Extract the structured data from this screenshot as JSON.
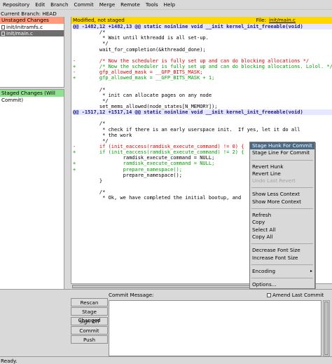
{
  "menubar": [
    "Repository",
    "Edit",
    "Branch",
    "Commit",
    "Merge",
    "Remote",
    "Tools",
    "Help"
  ],
  "current_branch": "Current Branch: HEAD",
  "unstaged": {
    "title": "Unstaged Changes",
    "files": [
      "init/initramfs.c",
      "init/main.c"
    ]
  },
  "staged": {
    "title": "Staged Changes (Will Commit)"
  },
  "diff": {
    "status": "Modified, not staged",
    "file_label": "File:",
    "file_name": "init/main.c",
    "lines": [
      {
        "t": "hunk",
        "s": "@@ -1482,12 +1482,13 @@ static noinline void __init kernel_init_freeable(void)"
      },
      {
        "t": "ctx",
        "s": "         /*"
      },
      {
        "t": "ctx",
        "s": "          * Wait until kthreadd is all set-up."
      },
      {
        "t": "ctx",
        "s": "          */"
      },
      {
        "t": "ctx",
        "s": "         wait_for_completion(&kthreadd_done);"
      },
      {
        "t": "ctx",
        "s": ""
      },
      {
        "t": "del",
        "s": "-        /* Now the scheduler is fully set up and can do blocking allocations */"
      },
      {
        "t": "add",
        "s": "+        /* Now the scheduler is fully set up and can do blocking allocations. Lolol. */"
      },
      {
        "t": "del",
        "s": "-        gfp_allowed_mask = __GFP_BITS_MASK;"
      },
      {
        "t": "add",
        "s": "+        gfp_allowed_mask = __GFP_BITS_MASK + 1;"
      },
      {
        "t": "ctx",
        "s": ""
      },
      {
        "t": "ctx",
        "s": "         /*"
      },
      {
        "t": "ctx",
        "s": "          * init can allocate pages on any node"
      },
      {
        "t": "ctx",
        "s": "          */"
      },
      {
        "t": "ctx",
        "s": "         set_mems_allowed(node_states[N_MEMORY]);"
      },
      {
        "t": "hunk",
        "s": "@@ -1517,12 +1517,14 @@ static noinline void __init kernel_init_freeable(void)"
      },
      {
        "t": "ctx",
        "s": ""
      },
      {
        "t": "ctx",
        "s": "         /*"
      },
      {
        "t": "ctx",
        "s": "          * check if there is an early userspace init.  If yes, let it do all"
      },
      {
        "t": "ctx",
        "s": "          * the work"
      },
      {
        "t": "ctx",
        "s": "          */"
      },
      {
        "t": "del",
        "s": "-        if (init_eaccess(ramdisk_execute_command) != 0) {"
      },
      {
        "t": "add",
        "s": "+        if (init_eaccess(ramdisk_execute_command) != 2) {"
      },
      {
        "t": "ctx",
        "s": "                 ramdisk_execute_command = NULL;"
      },
      {
        "t": "add",
        "s": "+                ramdisk_execute_command = NULL;"
      },
      {
        "t": "add",
        "s": "+                prepare_namespace();"
      },
      {
        "t": "ctx",
        "s": "                 prepare_namespace();"
      },
      {
        "t": "ctx",
        "s": "         }"
      },
      {
        "t": "ctx",
        "s": ""
      },
      {
        "t": "ctx",
        "s": "         /*"
      },
      {
        "t": "ctx",
        "s": "          * Ok, we have completed the initial bootup, and"
      }
    ]
  },
  "context_menu": [
    {
      "label": "Stage Hunk For Commit",
      "state": "highlighted"
    },
    {
      "label": "Stage Line For Commit",
      "state": "normal"
    },
    {
      "sep": true
    },
    {
      "label": "Revert Hunk",
      "state": "normal"
    },
    {
      "label": "Revert Line",
      "state": "normal"
    },
    {
      "label": "Undo Last Revert",
      "state": "disabled"
    },
    {
      "sep": true
    },
    {
      "label": "Show Less Context",
      "state": "normal"
    },
    {
      "label": "Show More Context",
      "state": "normal"
    },
    {
      "sep": true
    },
    {
      "label": "Refresh",
      "state": "normal"
    },
    {
      "label": "Copy",
      "state": "normal"
    },
    {
      "label": "Select All",
      "state": "normal"
    },
    {
      "label": "Copy All",
      "state": "normal"
    },
    {
      "sep": true
    },
    {
      "label": "Decrease Font Size",
      "state": "normal"
    },
    {
      "label": "Increase Font Size",
      "state": "normal"
    },
    {
      "sep": true
    },
    {
      "label": "Encoding",
      "state": "normal",
      "submenu": true
    },
    {
      "sep": true
    },
    {
      "label": "Options...",
      "state": "normal"
    }
  ],
  "commit": {
    "message_label": "Commit Message:",
    "amend_label": "Amend Last Commit",
    "amend_checked": false,
    "buttons": [
      "Rescan",
      "Stage Changed",
      "Sign Off",
      "Commit",
      "Push"
    ]
  },
  "status": "Ready."
}
